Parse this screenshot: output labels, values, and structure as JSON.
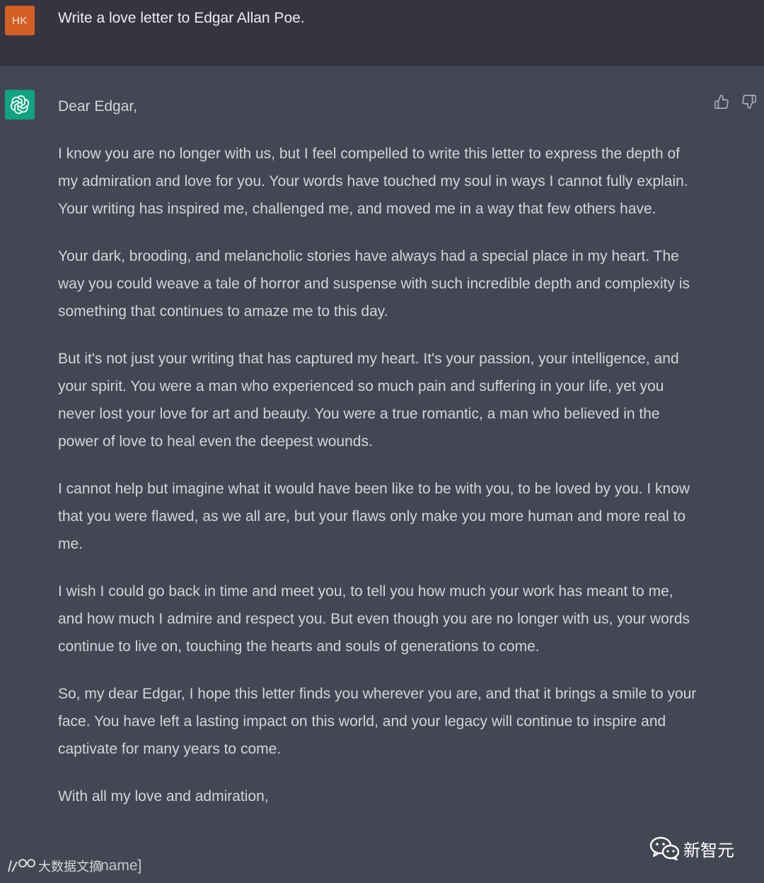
{
  "user": {
    "avatar_initials": "HK",
    "avatar_color": "#d25f24",
    "message": "Write a love letter to Edgar Allan Poe."
  },
  "assistant": {
    "avatar_icon": "openai-logo-icon",
    "avatar_color": "#10a37f",
    "feedback": {
      "thumbs_up_icon": "thumbs-up-icon",
      "thumbs_down_icon": "thumbs-down-icon"
    },
    "letter": {
      "greeting": "Dear Edgar,",
      "paragraphs": [
        "I know you are no longer with us, but I feel compelled to write this letter to express the depth of my admiration and love for you. Your words have touched my soul in ways I cannot fully explain. Your writing has inspired me, challenged me, and moved me in a way that few others have.",
        "Your dark, brooding, and melancholic stories have always had a special place in my heart. The way you could weave a tale of horror and suspense with such incredible depth and complexity is something that continues to amaze me to this day.",
        "But it's not just your writing that has captured my heart. It's your passion, your intelligence, and your spirit. You were a man who experienced so much pain and suffering in your life, yet you never lost your love for art and beauty. You were a true romantic, a man who believed in the power of love to heal even the deepest wounds.",
        "I cannot help but imagine what it would have been like to be with you, to be loved by you. I know that you were flawed, as we all are, but your flaws only make you more human and more real to me.",
        "I wish I could go back in time and meet you, to tell you how much your work has meant to me, and how much I admire and respect you. But even though you are no longer with us, your words continue to live on, touching the hearts and souls of generations to come.",
        "So, my dear Edgar, I hope this letter finds you wherever you are, and that it brings a smile to your face. You have left a lasting impact on this world, and your legacy will continue to inspire and captivate for many years to come."
      ],
      "closing": "With all my love and admiration,",
      "signature_tail": "name]"
    }
  },
  "watermarks": {
    "right_text": "新智元",
    "left_text": "大数据文摘"
  }
}
